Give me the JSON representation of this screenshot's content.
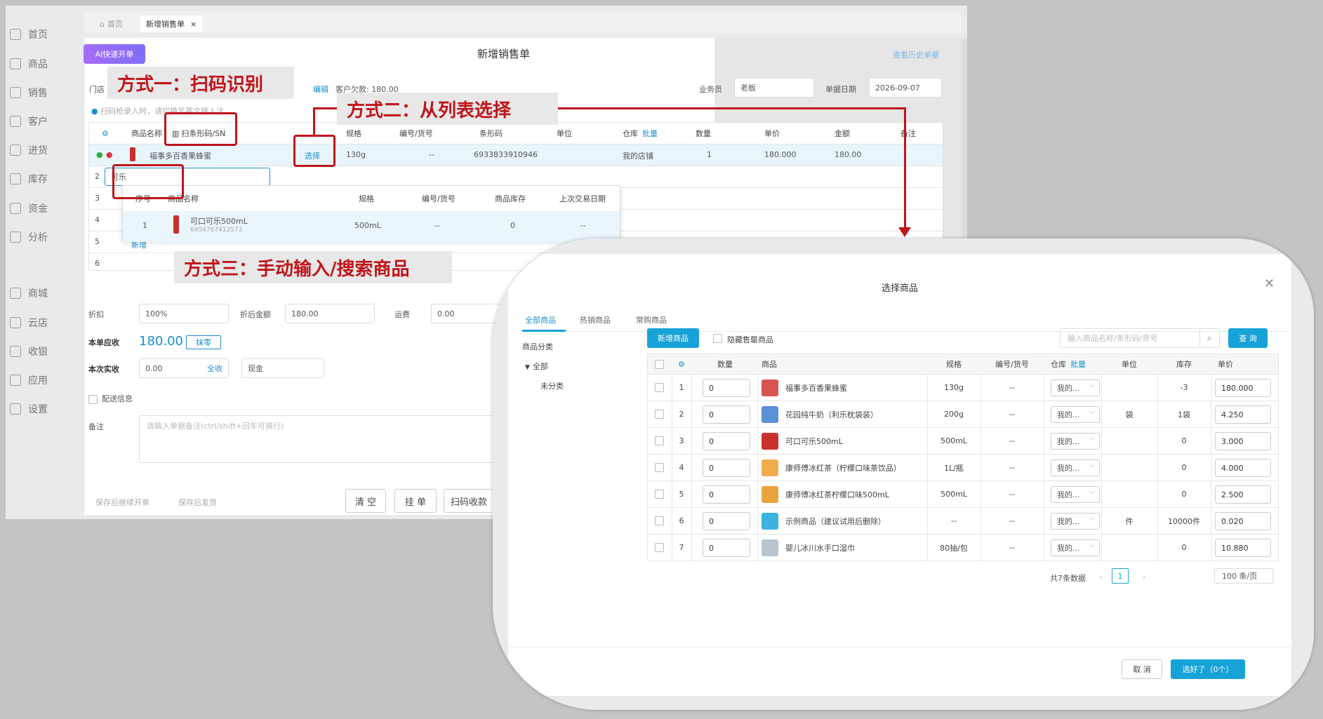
{
  "sidebar": {
    "items": [
      {
        "label": "首页",
        "icon": "home-icon"
      },
      {
        "label": "商品",
        "icon": "box-icon"
      },
      {
        "label": "销售",
        "icon": "receipt-icon"
      },
      {
        "label": "客户",
        "icon": "user-icon"
      },
      {
        "label": "进货",
        "icon": "inbound-icon"
      },
      {
        "label": "库存",
        "icon": "warehouse-icon"
      },
      {
        "label": "资金",
        "icon": "wallet-icon"
      },
      {
        "label": "分析",
        "icon": "chart-icon"
      },
      {
        "label": "商城",
        "icon": "shop-icon"
      },
      {
        "label": "云店",
        "icon": "cloud-store-icon"
      },
      {
        "label": "收银",
        "icon": "cashier-icon"
      },
      {
        "label": "应用",
        "icon": "apps-icon"
      },
      {
        "label": "设置",
        "icon": "gear-icon"
      }
    ]
  },
  "tabs": [
    {
      "label": "首页"
    },
    {
      "label": "新增销售单"
    }
  ],
  "form": {
    "ai_button": "AI快速开单",
    "title": "新增销售单",
    "history_link": "查看历史单据",
    "store_label": "门店",
    "edit_link": "编辑",
    "customer_debt": "客户欠款: 180.00",
    "salesman_label": "业务员",
    "salesman_value": "老板",
    "date_label": "单据日期",
    "date_value": "2026-09-07",
    "hint": "扫码枪录入时，请切换至英文输入法",
    "grid_headers": [
      "商品名称",
      "扫条形码/SN",
      "规格",
      "编号/货号",
      "条形码",
      "单位",
      "仓库",
      "批量",
      "数量",
      "单价",
      "金额",
      "备注"
    ],
    "row1": {
      "name": "福事多百香果蜂蜜",
      "select": "选择",
      "spec": "130g",
      "code": "--",
      "barcode": "6933833910946",
      "warehouse": "我的店铺",
      "qty": "1",
      "price": "180.000",
      "amount": "180.00"
    },
    "search_value": "可乐",
    "row_numbers": [
      "2",
      "3",
      "4",
      "5",
      "6"
    ],
    "add_link": "新增",
    "suggest_headers": [
      "序号",
      "商品名称",
      "规格",
      "编号/货号",
      "商品库存",
      "上次交易日期"
    ],
    "suggest_row": {
      "idx": "1",
      "name": "可口可乐500mL",
      "barcode": "6954767412573",
      "spec": "500mL",
      "code": "--",
      "stock": "0",
      "last": "--"
    },
    "discount_label": "折扣",
    "discount_value": "100%",
    "after_discount_label": "折后金额",
    "after_discount_value": "180.00",
    "freight_label": "运费",
    "freight_value": "0.00",
    "receivable_label": "本单应收",
    "receivable_value": "180.00",
    "erase_tag": "抹零",
    "paid_label": "本次实收",
    "paid_value": "0.00",
    "paid_all": "全收",
    "pay_method": "现金",
    "delivery_label": "配送信息",
    "remark_label": "备注",
    "remark_placeholder": "请输入单据备注(ctrl/shift+回车可换行)",
    "save_continue": "保存后继续开单",
    "save_ship": "保存后发货",
    "btn_clear": "清 空",
    "btn_hold": "挂 单",
    "btn_scan_pay": "扫码收款"
  },
  "callouts": {
    "method1": "方式一：扫码识别",
    "method2": "方式二：从列表选择",
    "method3": "方式三：手动输入/搜索商品"
  },
  "modal": {
    "title": "选择商品",
    "tabs": [
      "全部商品",
      "热销商品",
      "常购商品"
    ],
    "category_title": "商品分类",
    "category_all": "全部",
    "category_uncat": "未分类",
    "add_button": "新增商品",
    "hide_sold_out": "隐藏售罄商品",
    "search_placeholder": "输入商品名称/条形码/货号",
    "query_button": "查 询",
    "columns": [
      "数量",
      "商品",
      "规格",
      "编号/货号",
      "仓库",
      "批量",
      "单位",
      "库存",
      "单价"
    ],
    "rows": [
      {
        "idx": "1",
        "qty": "0",
        "name": "福事多百香果蜂蜜",
        "spec": "130g",
        "code": "--",
        "wh": "我的...",
        "unit": "",
        "stock": "-3",
        "price": "180.000",
        "thumb": "#d9534f"
      },
      {
        "idx": "2",
        "qty": "0",
        "name": "花园纯牛奶（利乐枕袋装）",
        "spec": "200g",
        "code": "--",
        "wh": "我的...",
        "unit": "袋",
        "stock": "1袋",
        "price": "4.250",
        "thumb": "#5b8fd6"
      },
      {
        "idx": "3",
        "qty": "0",
        "name": "可口可乐500mL",
        "spec": "500mL",
        "code": "--",
        "wh": "我的...",
        "unit": "",
        "stock": "0",
        "price": "3.000",
        "thumb": "#c9302c"
      },
      {
        "idx": "4",
        "qty": "0",
        "name": "康师傅冰红茶（柠檬口味茶饮品）",
        "spec": "1L/瓶",
        "code": "--",
        "wh": "我的...",
        "unit": "",
        "stock": "0",
        "price": "4.000",
        "thumb": "#f0ad4e"
      },
      {
        "idx": "5",
        "qty": "0",
        "name": "康师傅冰红茶柠檬口味500mL",
        "spec": "500mL",
        "code": "--",
        "wh": "我的...",
        "unit": "",
        "stock": "0",
        "price": "2.500",
        "thumb": "#e8a33d"
      },
      {
        "idx": "6",
        "qty": "0",
        "name": "示例商品（建议试用后删除）",
        "spec": "--",
        "code": "--",
        "wh": "我的...",
        "unit": "件",
        "stock": "10000件",
        "price": "0.020",
        "thumb": "#3bb3e0"
      },
      {
        "idx": "7",
        "qty": "0",
        "name": "婴儿冰川水手口湿巾",
        "spec": "80抽/包",
        "code": "--",
        "wh": "我的...",
        "unit": "",
        "stock": "0",
        "price": "10.880",
        "thumb": "#b9c4cc"
      }
    ],
    "total_text": "共7条数据",
    "page": "1",
    "per_page": "100 条/页",
    "cancel": "取 消",
    "confirm": "选好了（0个）"
  },
  "colors": {
    "accent": "#17a2d8",
    "callout_red": "#c0141b"
  }
}
